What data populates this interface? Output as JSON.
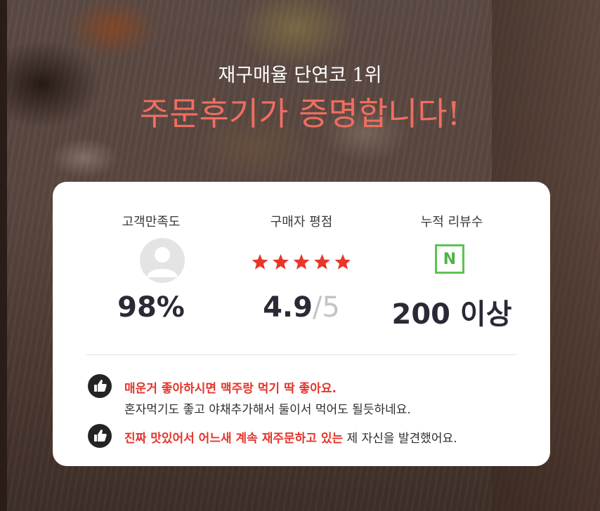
{
  "header": {
    "subtitle": "재구매율 단연코 1위",
    "title": "주문후기가 증명합니다!"
  },
  "stats": [
    {
      "label": "고객만족도",
      "value": "98%",
      "icon": "user-avatar-icon"
    },
    {
      "label": "구매자 평점",
      "value": "4.9",
      "denominator": "/5",
      "rating": 4.9,
      "max": 5,
      "icon": "star-rating-icon"
    },
    {
      "label": "누적 리뷰수",
      "value": "200 이상",
      "icon": "naver-icon",
      "badge": "N"
    }
  ],
  "reviews": [
    {
      "highlight": "매운거 좋아하시면 맥주랑 먹기 딱 좋아요.",
      "rest": "",
      "line2": "혼자먹기도 좋고 야채추가해서 둘이서 먹어도 될듯하네요.",
      "icon": "thumbs-up-icon"
    },
    {
      "highlight": "진짜 맛있어서 어느새 계속 재주문하고 있는",
      "rest": " 제 자신을 발견했어요.",
      "icon": "thumbs-up-icon"
    }
  ],
  "colors": {
    "title_accent": "#f06e61",
    "star": "#e8362a",
    "highlight": "#e4352b",
    "naver_green": "#5bc451",
    "value_text": "#2a2a36"
  }
}
